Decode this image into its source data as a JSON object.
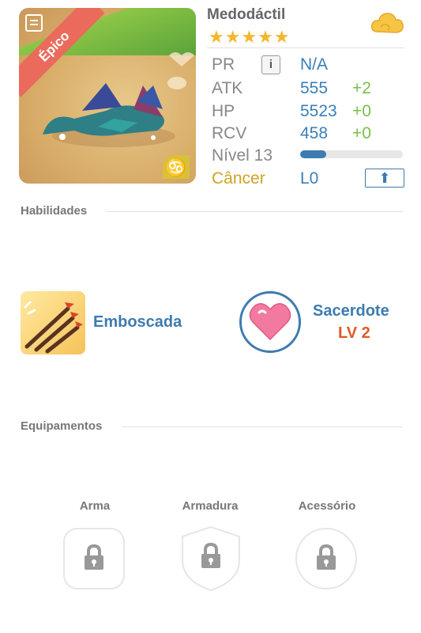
{
  "monster": {
    "name": "Medodáctil",
    "rarity": "Épico",
    "stars": "★★★★★"
  },
  "stats": {
    "pr": {
      "label": "PR",
      "value": "N/A"
    },
    "atk": {
      "label": "ATK",
      "value": "555",
      "bonus": "+2"
    },
    "hp": {
      "label": "HP",
      "value": "5523",
      "bonus": "+0"
    },
    "rcv": {
      "label": "RCV",
      "value": "458",
      "bonus": "+0"
    },
    "level": {
      "label": "Nível 13",
      "progress": 0.25
    },
    "zodiac": {
      "label": "Câncer",
      "value": "L0",
      "glyph": "♋"
    }
  },
  "sections": {
    "skills_title": "Habilidades",
    "equipment_title": "Equipamentos"
  },
  "skills": {
    "active": {
      "name": "Emboscada",
      "icon": "arrows-icon"
    },
    "leader": {
      "name": "Sacerdote",
      "level": "LV 2",
      "icon": "heart-icon"
    }
  },
  "equipment": [
    {
      "label": "Arma",
      "icon": "lock-icon"
    },
    {
      "label": "Armadura",
      "icon": "lock-icon"
    },
    {
      "label": "Acessório",
      "icon": "lock-icon"
    }
  ],
  "colors": {
    "accent": "#3d7bb0",
    "bonus": "#78c04a",
    "zodiac": "#cfa323",
    "rarity_ribbon": "#ea6b5c",
    "leader_level": "#e05a24"
  }
}
